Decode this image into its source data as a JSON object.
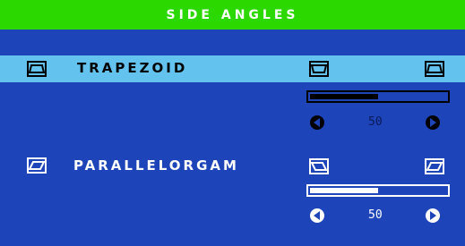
{
  "menu": {
    "title": "SIDE ANGLES",
    "items": [
      {
        "label": "TRAPEZOID",
        "selected": true,
        "icon": "trapezoid-icon",
        "left_icon": "trapezoid-narrow-bottom-icon",
        "right_icon": "trapezoid-narrow-top-icon",
        "value": "50",
        "level": 0.5
      },
      {
        "label": "PARALLELORGAM",
        "selected": false,
        "icon": "parallelogram-icon",
        "left_icon": "parallelogram-left-icon",
        "right_icon": "parallelogram-right-icon",
        "value": "50",
        "level": 0.5
      }
    ]
  },
  "colors": {
    "header": "#2bd800",
    "background": "#1d44b8",
    "highlight": "#63c3ee",
    "text": "#ffffff",
    "selected_text": "#000000",
    "disabled_text": "#0a1a5a"
  }
}
